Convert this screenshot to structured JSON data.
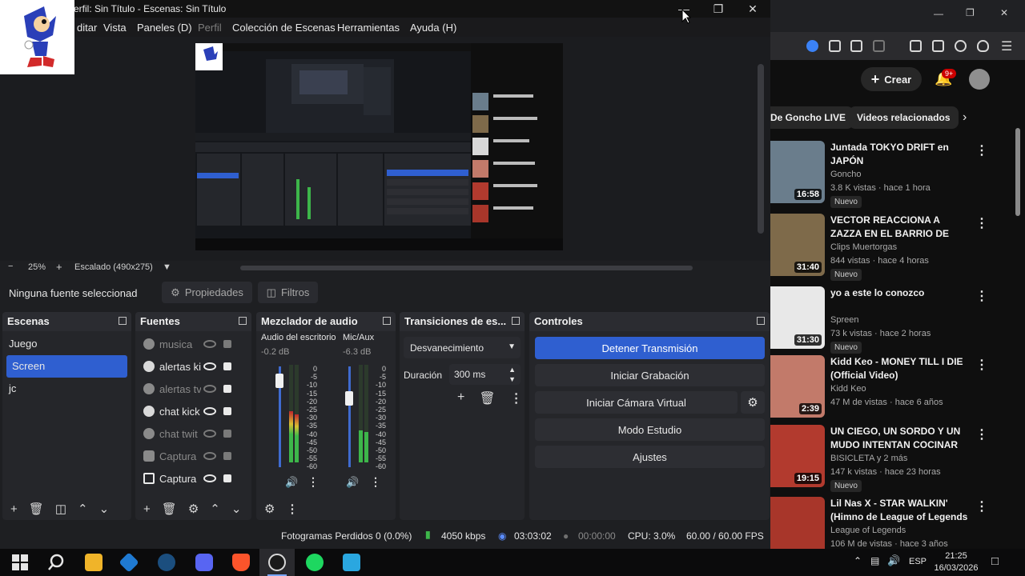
{
  "obs": {
    "title": "erfil: Sin Título - Escenas: Sin Título",
    "menu": [
      {
        "label": "ditar",
        "dim": false
      },
      {
        "label": "Vista",
        "dim": false
      },
      {
        "label": "Paneles (D)",
        "dim": false
      },
      {
        "label": "Perfil",
        "dim": true
      },
      {
        "label": "Colección de Escenas",
        "dim": false
      },
      {
        "label": "Herramientas",
        "dim": false
      },
      {
        "label": "Ayuda (H)",
        "dim": false
      }
    ],
    "zoom": {
      "minus": "−",
      "level": "25%",
      "plus": "+",
      "scaling": "Escalado (490x275)"
    },
    "source_bar": {
      "no_source": "Ninguna fuente seleccionad",
      "properties": "Propiedades",
      "filters": "Filtros"
    },
    "scenes": {
      "title": "Escenas",
      "items": [
        {
          "label": "Juego",
          "selected": false
        },
        {
          "label": "Screen",
          "selected": true
        },
        {
          "label": "jc",
          "selected": false
        }
      ]
    },
    "sources": {
      "title": "Fuentes",
      "items": [
        {
          "label": "musica",
          "visible": false
        },
        {
          "label": "alertas ki",
          "visible": true
        },
        {
          "label": "alertas tv",
          "visible": false
        },
        {
          "label": "chat kick",
          "visible": true
        },
        {
          "label": "chat twit",
          "visible": false
        },
        {
          "label": "Captura",
          "visible": false
        },
        {
          "label": "Captura",
          "visible": true
        }
      ]
    },
    "mixer": {
      "title": "Mezclador de audio",
      "channels": [
        {
          "name": "Audio del escritorio",
          "db": "-0.2 dB",
          "level": 0.92
        },
        {
          "name": "Mic/Aux",
          "db": "-6.3 dB",
          "level": 0.72
        }
      ],
      "scale": [
        "0",
        "-5",
        "-10",
        "-15",
        "-20",
        "-25",
        "-30",
        "-35",
        "-40",
        "-45",
        "-50",
        "-55",
        "-60"
      ]
    },
    "transitions": {
      "title": "Transiciones de es...",
      "selected": "Desvanecimiento",
      "duration_label": "Duración",
      "duration_value": "300 ms"
    },
    "controls": {
      "title": "Controles",
      "buttons": [
        "Detener Transmisión",
        "Iniciar Grabación",
        "Iniciar Cámara Virtual",
        "Modo Estudio",
        "Ajustes"
      ]
    },
    "status": {
      "dropped": "Fotogramas Perdidos 0 (0.0%)",
      "bitrate": "4050 kbps",
      "stream_time": "03:03:02",
      "rec_time": "00:00:00",
      "cpu": "CPU: 3.0%",
      "fps": "60.00 / 60.00 FPS"
    }
  },
  "youtube": {
    "create_label": "Crear",
    "notif_count": "9+",
    "chips": [
      "De Goncho LIVE",
      "Videos relacionados"
    ],
    "videos": [
      {
        "title": "Juntada TOKYO DRIFT en JAPÓN",
        "channel": "Goncho",
        "meta": "3.8 K vistas · hace 1 hora",
        "badge": "Nuevo",
        "duration": "16:58",
        "color": "#6a7d8c"
      },
      {
        "title": "VECTOR REACCIONA A ZAZZA EN EL BARRIO DE LOS ...",
        "channel": "Clips Muertorgas",
        "meta": "844 vistas · hace 4 horas",
        "badge": "Nuevo",
        "duration": "31:40",
        "color": "#7e6a4a"
      },
      {
        "title": "yo a este lo conozco",
        "channel": "Spreen",
        "meta": "73 k vistas · hace 2 horas",
        "badge": "Nuevo",
        "duration": "31:30",
        "color": "#e8e8e8"
      },
      {
        "title": "Kidd Keo -  MONEY TILL I DIE (Official Video)",
        "channel": "Kidd Keo",
        "meta": "47 M de vistas · hace 6 años",
        "badge": "",
        "duration": "2:39",
        "color": "#c27a6a"
      },
      {
        "title": "UN CIEGO, UN SORDO Y UN MUDO INTENTAN COCINAR",
        "channel": "BISICLETA y 2 más",
        "meta": "147 k vistas · hace 23 horas",
        "badge": "Nuevo",
        "duration": "19:15",
        "color": "#b23a2e"
      },
      {
        "title": "Lil Nas X - STAR WALKIN' (Himno de League of Legends ...",
        "channel": "League of Legends",
        "meta": "106 M de vistas · hace 3 años",
        "badge": "",
        "duration": "",
        "color": "#a8362a"
      }
    ]
  },
  "taskbar": {
    "lang": "ESP",
    "time": "21:25",
    "date": "16/03/2026"
  }
}
